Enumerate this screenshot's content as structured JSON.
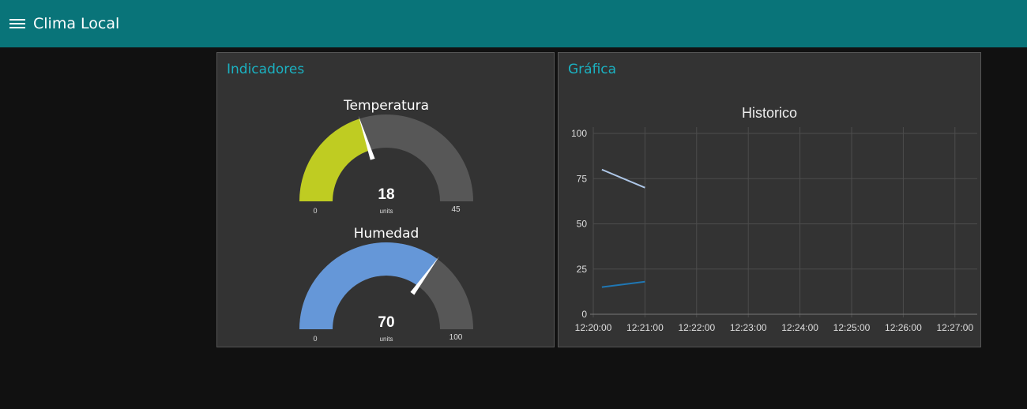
{
  "app": {
    "title": "Clima Local",
    "menu_icon": "hamburger-menu-icon",
    "header_color": "#097479"
  },
  "indicators": {
    "title": "Indicadores",
    "gauges": [
      {
        "label": "Temperatura",
        "value": 18,
        "units": "units",
        "min": 0,
        "max": 45,
        "min_label": "0",
        "max_label": "45",
        "color": "#bfcc22"
      },
      {
        "label": "Humedad",
        "value": 70,
        "units": "units",
        "min": 0,
        "max": 100,
        "min_label": "0",
        "max_label": "100",
        "color": "#6597d8"
      }
    ]
  },
  "chart_panel": {
    "title": "Gráfica"
  },
  "chart_data": {
    "type": "line",
    "title": "Historico",
    "xlabel": "",
    "ylabel": "",
    "ylim": [
      0,
      100
    ],
    "yticks": [
      "0",
      "25",
      "50",
      "75",
      "100"
    ],
    "xticks": [
      "12:20:00",
      "12:21:00",
      "12:22:00",
      "12:23:00",
      "12:24:00",
      "12:25:00",
      "12:26:00",
      "12:27:00"
    ],
    "grid": true,
    "legend": "none",
    "series": [
      {
        "color": "#aec7e8",
        "x": [
          "12:20:10",
          "12:21:00"
        ],
        "values": [
          80,
          70
        ]
      },
      {
        "color": "#1f77b4",
        "x": [
          "12:20:10",
          "12:21:00"
        ],
        "values": [
          15,
          18
        ]
      }
    ]
  }
}
